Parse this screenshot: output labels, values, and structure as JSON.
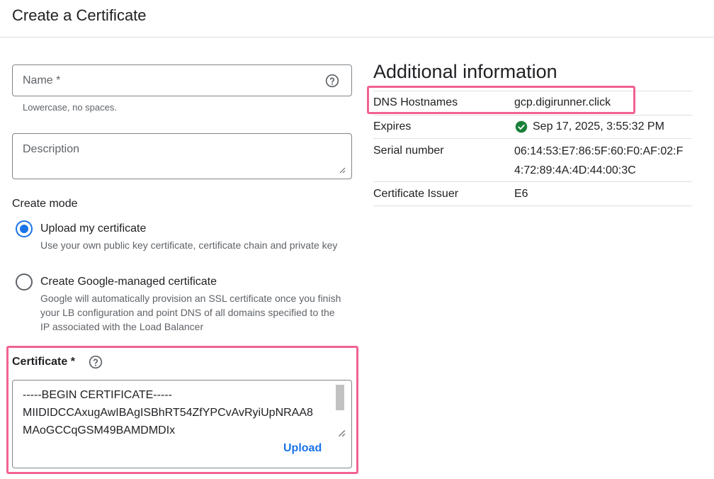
{
  "header": {
    "title": "Create a Certificate"
  },
  "form": {
    "name": {
      "placeholder": "Name *",
      "hint": "Lowercase, no spaces."
    },
    "description": {
      "placeholder": "Description"
    },
    "create_mode": {
      "label": "Create mode",
      "options": [
        {
          "label": "Upload my certificate",
          "description": "Use your own public key certificate, certificate chain and private key",
          "selected": true
        },
        {
          "label": "Create Google-managed certificate",
          "description": "Google will automatically provision an SSL certificate once you finish your LB configuration and point DNS of all domains specified to the IP associated with the Load Balancer",
          "selected": false
        }
      ]
    },
    "certificate": {
      "label": "Certificate *",
      "value": "-----BEGIN CERTIFICATE-----\nMIIDIDCCAxugAwIBAgISBhRT54ZfYPCvAvRyiUpNRAA8\nMAoGCCqGSM49BAMDMDIx",
      "upload_label": "Upload"
    }
  },
  "additional_info": {
    "title": "Additional information",
    "rows": [
      {
        "key": "DNS Hostnames",
        "value": "gcp.digirunner.click"
      },
      {
        "key": "Expires",
        "value": "Sep 17, 2025, 3:55:32 PM",
        "status_icon": "check-circle-icon"
      },
      {
        "key": "Serial number",
        "value_line1": "06:14:53:E7:86:5F:60:F0:AF:02:F",
        "value_line2": "4:72:89:4A:4D:44:00:3C"
      },
      {
        "key": "Certificate Issuer",
        "value": "E6"
      }
    ]
  },
  "colors": {
    "accent": "#1a73e8",
    "highlight": "#f06292",
    "success": "#188038"
  }
}
